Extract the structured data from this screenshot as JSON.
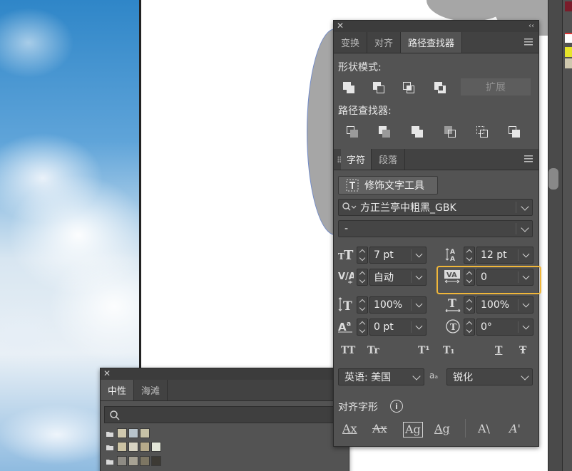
{
  "pathfinder_panel": {
    "tabs": [
      "变换",
      "对齐",
      "路径查找器"
    ],
    "active_tab": 2,
    "shape_modes_label": "形状模式:",
    "expand_label": "扩展",
    "pathfinders_label": "路径查找器:"
  },
  "character_panel": {
    "tabs": [
      "字符",
      "段落"
    ],
    "touch_type_label": "修饰文字工具",
    "font_family": "方正兰亭中粗黑_GBK",
    "font_style": "-",
    "font_size": "7 pt",
    "leading": "12 pt",
    "kerning": "自动",
    "tracking": "0",
    "vertical_scale": "100%",
    "horizontal_scale": "100%",
    "baseline_shift": "0 pt",
    "rotation": "0°",
    "language": "英语: 美国",
    "antialias": "锐化",
    "snap_label": "对齐字形",
    "style_buttons": [
      "TT",
      "Tr",
      "T¹",
      "T₁",
      "T",
      "Ŧ"
    ]
  },
  "swatches_panel": {
    "tabs": [
      "中性",
      "海滩"
    ],
    "active_tab": 0,
    "colors": {
      "row1": [
        "#cfc8ae",
        "#b8c4cc",
        "#c6c1a6"
      ],
      "row2": [
        "#cbc2a3",
        "#d7d3c2",
        "#b6aa8a",
        "#e3e6d8"
      ],
      "row3": [
        "#8e8b84",
        "#a7a294",
        "#7d7663",
        "#3d3a34"
      ]
    }
  },
  "accent": {
    "highlight": "#f1b73a"
  }
}
